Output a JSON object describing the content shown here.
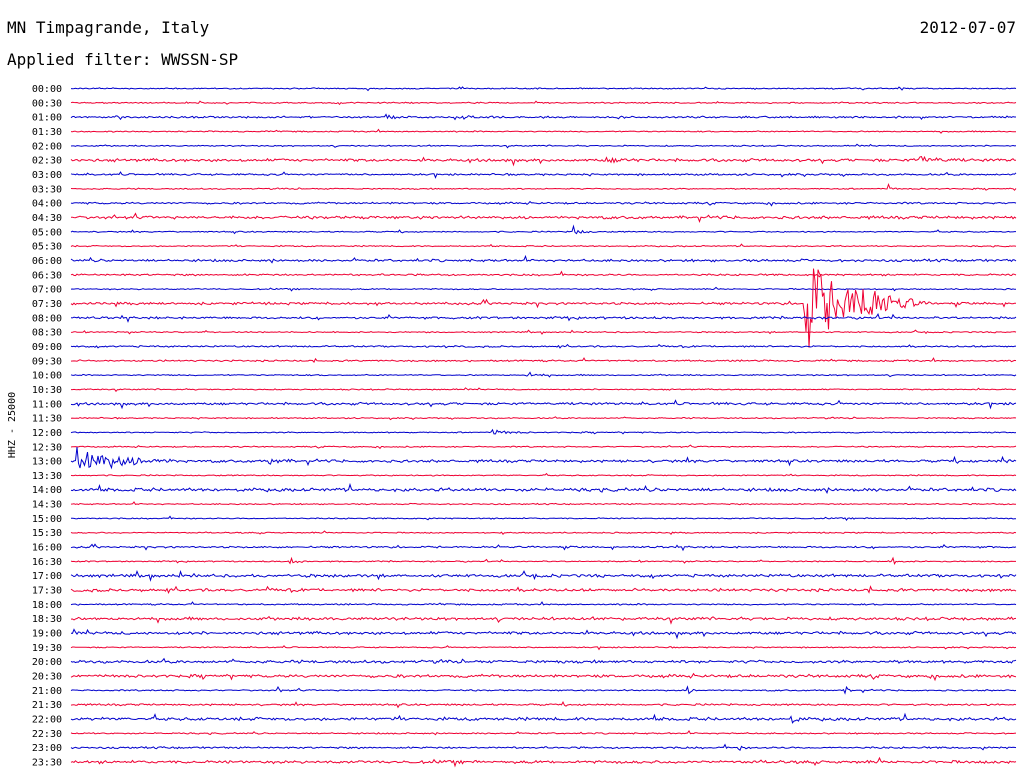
{
  "header": {
    "station": "MN Timpagrande, Italy",
    "date": "2012-07-07",
    "filter": "Applied filter: WWSSN-SP"
  },
  "chart_data": {
    "type": "line",
    "title": "MN Timpagrande, Italy",
    "subtitle": "Applied filter: WWSSN-SP",
    "ylabel": "HHZ - 25000",
    "xlabel": "",
    "colors": {
      "even": "#0000cc",
      "odd": "#ee0033"
    },
    "row_labels": [
      "00:00",
      "00:30",
      "01:00",
      "01:30",
      "02:00",
      "02:30",
      "03:00",
      "03:30",
      "04:00",
      "04:30",
      "05:00",
      "05:30",
      "06:00",
      "06:30",
      "07:00",
      "07:30",
      "08:00",
      "08:30",
      "09:00",
      "09:30",
      "10:00",
      "10:30",
      "11:00",
      "11:30",
      "12:00",
      "12:30",
      "13:00",
      "13:30",
      "14:00",
      "14:30",
      "15:00",
      "15:30",
      "16:00",
      "16:30",
      "17:00",
      "17:30",
      "18:00",
      "18:30",
      "19:00",
      "19:30",
      "20:00",
      "20:30",
      "21:00",
      "21:30",
      "22:00",
      "22:30",
      "23:00",
      "23:30"
    ],
    "noise": [
      0.6,
      0.6,
      0.9,
      0.6,
      0.6,
      1.4,
      0.9,
      0.6,
      0.9,
      1.4,
      0.6,
      0.6,
      1.2,
      0.9,
      0.6,
      1.2,
      1.1,
      0.6,
      0.8,
      0.8,
      0.6,
      0.6,
      1.2,
      0.6,
      0.6,
      0.6,
      1.3,
      0.6,
      1.6,
      0.6,
      0.6,
      0.6,
      0.9,
      0.6,
      1.4,
      1.4,
      0.7,
      1.4,
      1.4,
      0.6,
      1.4,
      1.4,
      0.7,
      0.9,
      1.5,
      0.7,
      0.9,
      1.4
    ],
    "events": [
      {
        "row": 2,
        "minute": 10,
        "amplitude": 2,
        "duration_min": 1.2
      },
      {
        "row": 2,
        "minute": 12.5,
        "amplitude": 2,
        "duration_min": 1
      },
      {
        "row": 5,
        "minute": 17,
        "amplitude": 2,
        "duration_min": 1.5
      },
      {
        "row": 5,
        "minute": 27,
        "amplitude": 3,
        "duration_min": 1.5
      },
      {
        "row": 7,
        "minute": 26,
        "amplitude": 3,
        "duration_min": 0.3
      },
      {
        "row": 10,
        "minute": 16,
        "amplitude": 4,
        "duration_min": 0.6
      },
      {
        "row": 15,
        "minute": 23.3,
        "amplitude": 50,
        "duration_min": 3.5
      },
      {
        "row": 15,
        "minute": 24.9,
        "amplitude": 14,
        "duration_min": 2.5
      },
      {
        "row": 20,
        "minute": 14.5,
        "amplitude": 3,
        "duration_min": 0.8
      },
      {
        "row": 24,
        "minute": 13.4,
        "amplitude": 3,
        "duration_min": 1.2
      },
      {
        "row": 26,
        "minute": 0.2,
        "amplitude": 16,
        "duration_min": 3.2
      },
      {
        "row": 26,
        "minute": 6.3,
        "amplitude": 3,
        "duration_min": 0.9
      },
      {
        "row": 26,
        "minute": 29.6,
        "amplitude": 3,
        "duration_min": 0.3
      },
      {
        "row": 33,
        "minute": 7,
        "amplitude": 3,
        "duration_min": 0.6
      },
      {
        "row": 33,
        "minute": 26.1,
        "amplitude": 3,
        "duration_min": 0.4
      },
      {
        "row": 42,
        "minute": 6.6,
        "amplitude": 3,
        "duration_min": 0.3
      },
      {
        "row": 42,
        "minute": 19.6,
        "amplitude": 3,
        "duration_min": 0.3
      },
      {
        "row": 42,
        "minute": 24.6,
        "amplitude": 3,
        "duration_min": 0.3
      },
      {
        "row": 44,
        "minute": 22.9,
        "amplitude": 3,
        "duration_min": 0.5
      },
      {
        "row": 46,
        "minute": 21.2,
        "amplitude": 3,
        "duration_min": 0.3
      }
    ]
  }
}
